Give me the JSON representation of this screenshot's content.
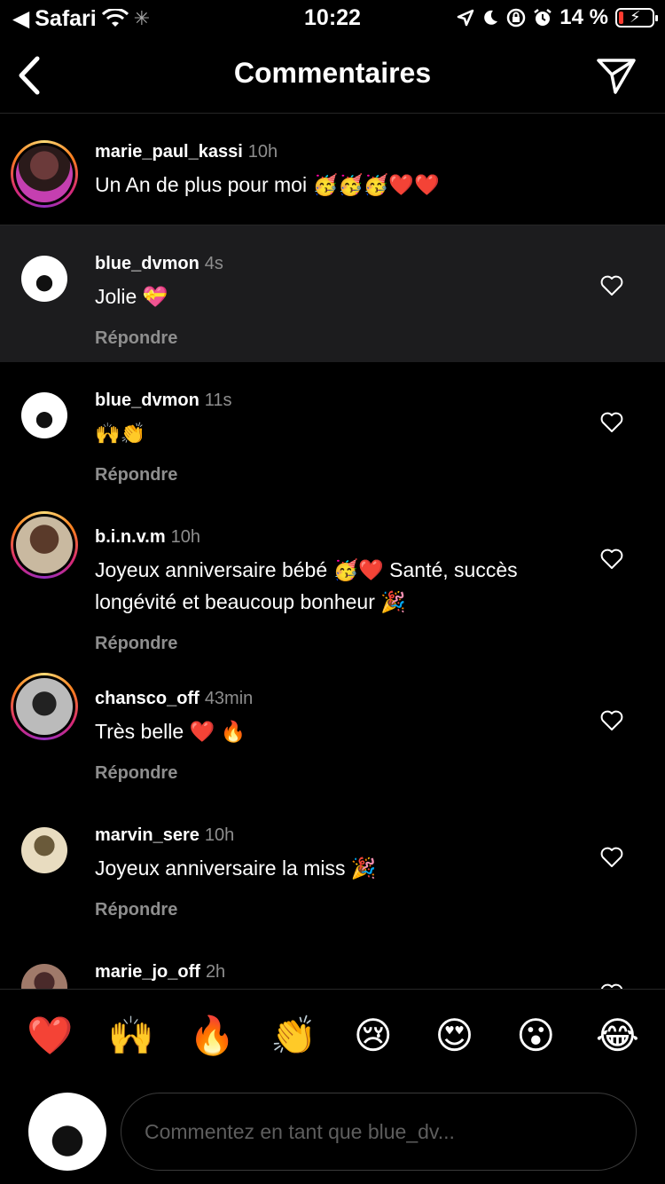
{
  "status_bar": {
    "back_app": "Safari",
    "time": "10:22",
    "battery": "14 %",
    "battery_level": 0.14
  },
  "nav": {
    "title": "Commentaires"
  },
  "caption": {
    "username": "marie_paul_kassi",
    "time": "10h",
    "text": "Un An de plus pour moi 🥳🥳🥳❤️❤️"
  },
  "comments": [
    {
      "username": "blue_dvmon",
      "time": "4s",
      "text": "Jolie 💝",
      "reply": "Répondre"
    },
    {
      "username": "blue_dvmon",
      "time": "11s",
      "text": "🙌👏",
      "reply": "Répondre"
    },
    {
      "username": "b.i.n.v.m",
      "time": "10h",
      "text": "Joyeux anniversaire bébé 🥳❤️ Santé, succès longévité et beaucoup bonheur 🎉",
      "reply": "Répondre"
    },
    {
      "username": "chansco_off",
      "time": "43min",
      "text": "Très belle ❤️ 🔥",
      "reply": "Répondre"
    },
    {
      "username": "marvin_sere",
      "time": "10h",
      "text": "Joyeux anniversaire la miss 🎉",
      "reply": "Répondre"
    },
    {
      "username": "marie_jo_off",
      "time": "2h",
      "text": "",
      "reply": ""
    }
  ],
  "reactions": [
    "❤️",
    "🙌",
    "🔥",
    "👏",
    "😢",
    "😍",
    "😮",
    "😂"
  ],
  "comment_input": {
    "placeholder": "Commentez en tant que blue_dv..."
  },
  "colors": {
    "background": "#000000",
    "muted": "#8e8e8e",
    "highlight": "#1c1c1e",
    "battery_low": "#ff3b30"
  },
  "icons": [
    "back-arrow-icon",
    "wifi-icon",
    "location-icon",
    "moon-icon",
    "lock-rotation-icon",
    "alarm-icon",
    "send-icon",
    "heart-icon"
  ]
}
